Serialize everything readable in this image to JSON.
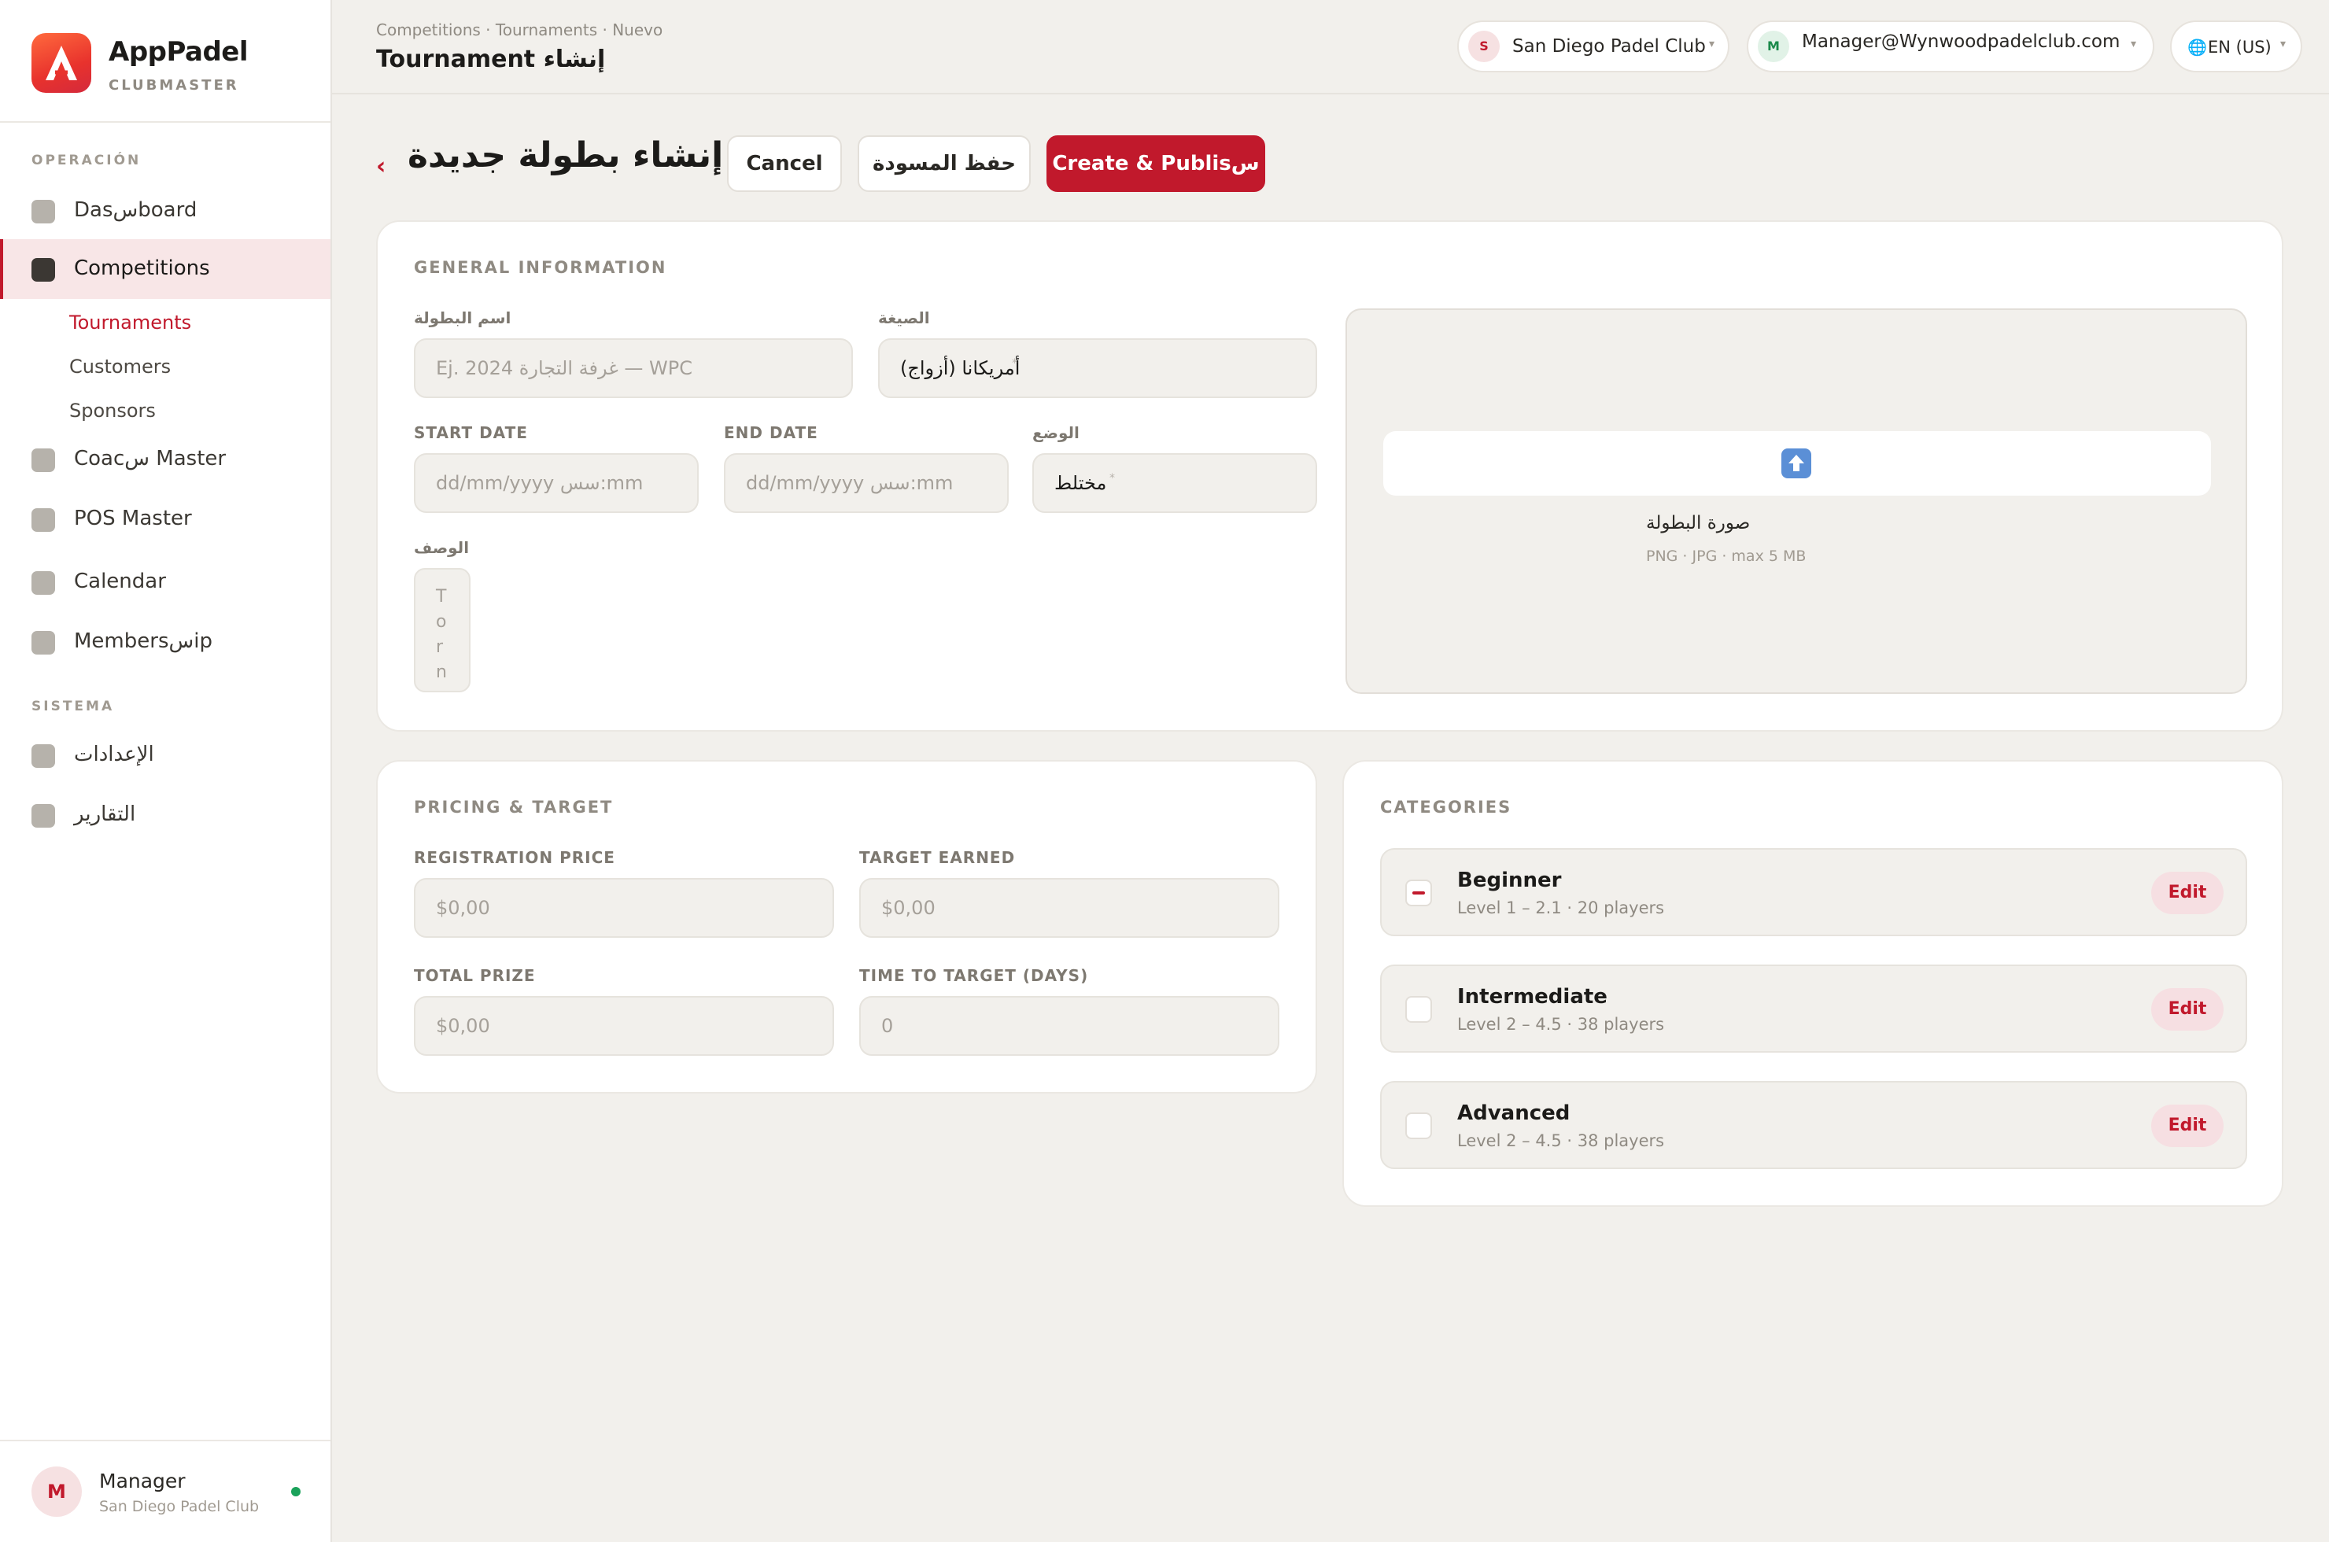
{
  "brand": {
    "name": "AppPadel",
    "sub": "CLUBMASTER"
  },
  "sidebar": {
    "section_operation": "OPERACIÓN",
    "section_system": "SISTEMA",
    "items": [
      {
        "label": "Dasسboard"
      },
      {
        "label": "Competitions"
      },
      {
        "label": "Coacس Master"
      },
      {
        "label": "POS Master"
      },
      {
        "label": "Calendar"
      },
      {
        "label": "Membersسip"
      }
    ],
    "sub_items": [
      {
        "label": "Tournaments"
      },
      {
        "label": "Customers"
      },
      {
        "label": "Sponsors"
      }
    ],
    "system_items": [
      {
        "label": "الإعدادات"
      },
      {
        "label": "التقارير"
      }
    ],
    "user": {
      "initial": "M",
      "name": "Manager",
      "club": "San Diego Padel Club"
    }
  },
  "topbar": {
    "breadcrumb": "Competitions · Tournaments · Nuevo",
    "title": "Tournament إنشاء",
    "club": {
      "initial": "S",
      "name": "San Diego Padel Club"
    },
    "account": {
      "initial": "M",
      "email": "Manager@Wynwoodpadelclub.com"
    },
    "language": "EN (US)"
  },
  "header": {
    "back": "‹",
    "title": "إنشاء بطولة جديدة",
    "cancel": "Cancel",
    "save_draft": "حفظ المسودة",
    "publish": "Create & Publisس"
  },
  "general": {
    "title": "GENERAL INFORMATION",
    "name_label": "اسم البطولة",
    "name_placeholder": "Ej. 2024 غرفة التجارة — WPC",
    "format_label": "الصيغة",
    "format_value": "أمريكانا (أزواج)",
    "start_label": "START DATE",
    "start_placeholder": "dd/mm/yyyy سس:mm",
    "end_label": "END DATE",
    "end_placeholder": "dd/mm/yyyy سس:mm",
    "mode_label": "الوضع",
    "mode_value": "مختلط",
    "desc_label": "الوصف",
    "desc_chars": [
      "T",
      "o",
      "r",
      "n"
    ],
    "upload_title": "صورة البطولة",
    "upload_hint": "PNG · JPG · max 5 MB"
  },
  "pricing": {
    "title": "PRICING & TARGET",
    "reg_label": "REGISTRATION PRICE",
    "reg_placeholder": "$0,00",
    "target_label": "TARGET EARNED",
    "target_placeholder": "$0,00",
    "prize_label": "TOTAL PRIZE",
    "prize_placeholder": "$0,00",
    "days_label": "TIME TO TARGET (DAYS)",
    "days_placeholder": "0"
  },
  "categories": {
    "title": "CATEGORIES",
    "items": [
      {
        "name": "Beginner",
        "meta": "Level 1 – 2.1 · 20 players",
        "checked": true,
        "edit": "Edit"
      },
      {
        "name": "Intermediate",
        "meta": "Level 2 – 4.5 · 38 players",
        "checked": false,
        "edit": "Edit"
      },
      {
        "name": "Advanced",
        "meta": "Level 2 – 4.5 · 38 players",
        "checked": false,
        "edit": "Edit"
      }
    ]
  },
  "colors": {
    "accent": "#c1192c",
    "background": "#f2f0ec",
    "card": "#ffffff"
  },
  "icons": {
    "logo": "apppadel-logo",
    "upload": "upload-icon",
    "language": "globe-icon"
  }
}
